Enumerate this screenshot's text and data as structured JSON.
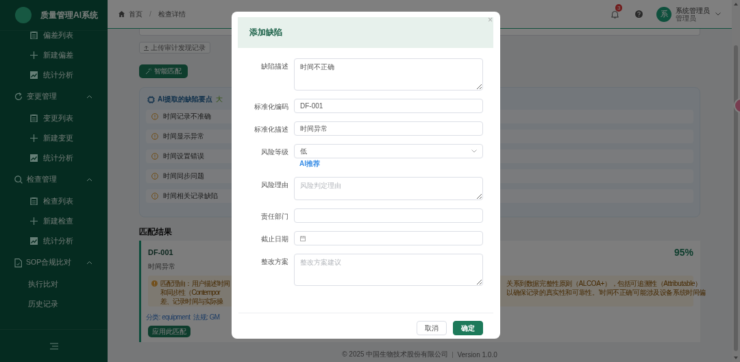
{
  "sidebar": {
    "title": "质量管理AI系统",
    "items": [
      {
        "kind": "list",
        "label": "偏差列表"
      },
      {
        "kind": "create",
        "label": "新建偏差"
      },
      {
        "kind": "stats",
        "label": "统计分析"
      },
      {
        "kind": "cycle-group",
        "label": "变更管理",
        "expanded": true,
        "children": [
          {
            "kind": "list",
            "label": "变更列表"
          },
          {
            "kind": "create",
            "label": "新建变更"
          },
          {
            "kind": "stats",
            "label": "统计分析"
          }
        ]
      },
      {
        "kind": "search-group",
        "label": "检查管理",
        "expanded": true,
        "children": [
          {
            "kind": "list",
            "label": "检查列表"
          },
          {
            "kind": "create",
            "label": "新建检查"
          },
          {
            "kind": "stats",
            "label": "统计分析"
          }
        ]
      },
      {
        "kind": "doc-group",
        "label": "SOP合规比对",
        "expanded": true,
        "children": [
          {
            "kind": "plain",
            "label": "执行比对"
          },
          {
            "kind": "plain",
            "label": "历史记录"
          }
        ]
      }
    ]
  },
  "header": {
    "breadcrumb": [
      "首页",
      "检查详情"
    ],
    "breadcrumb_separator": "/",
    "notification_count": "3",
    "user": {
      "avatar": "系",
      "name": "系统管理员",
      "role": "管理员"
    }
  },
  "content": {
    "upload_button": "上传审计发现记录",
    "match_button": "智能匹配",
    "ai_points": {
      "title": "AI提取的缺陷要点",
      "tag": "大",
      "items": [
        "时间记录不准确",
        "时间显示异常",
        "时间设置错误",
        "时间同步问题",
        "时间相关记录缺陷"
      ]
    },
    "match_heading": "匹配结果",
    "match": {
      "code": "DF-001",
      "score": "95%",
      "description": "时间异常",
      "reason_left": [
        "匹配理由：用户描述'时间",
        "和同步性（Contempor",
        "差、记录时间与实际操"
      ],
      "reason_right": [
        "关系到数据完整性原则（ALCOA+），包括可追溯性（Attributable）",
        "以确保记录的真实性和可靠性。'时间不正确'可能涉及设备系统时间偏"
      ],
      "tags": [
        "分类: equipment",
        "法规: GM"
      ],
      "apply_button": "应用此匹配"
    }
  },
  "footer": {
    "copyright": "© 2025 中国生物技术股份有限公司",
    "version": "Version 1.0.0"
  },
  "dialog": {
    "title": "添加缺陷",
    "close": "×",
    "fields": [
      {
        "kind": "textarea",
        "label": "缺陷描述",
        "value": "时间不正确"
      },
      {
        "kind": "input",
        "label": "标准化编码",
        "value": "DF-001"
      },
      {
        "kind": "input",
        "label": "标准化描述",
        "value": "时间异常"
      },
      {
        "kind": "select",
        "label": "风险等级",
        "value": "低",
        "hint": "AI推荐"
      },
      {
        "kind": "textarea-small",
        "label": "风险理由",
        "placeholder": "风险判定理由"
      },
      {
        "kind": "input",
        "label": "责任部门"
      },
      {
        "kind": "date",
        "label": "截止日期"
      },
      {
        "kind": "textarea",
        "label": "整改方案",
        "placeholder": "整改方案建议"
      }
    ],
    "buttons": [
      {
        "kind": "secondary",
        "label": "取消"
      },
      {
        "kind": "primary",
        "label": "确定"
      }
    ]
  }
}
